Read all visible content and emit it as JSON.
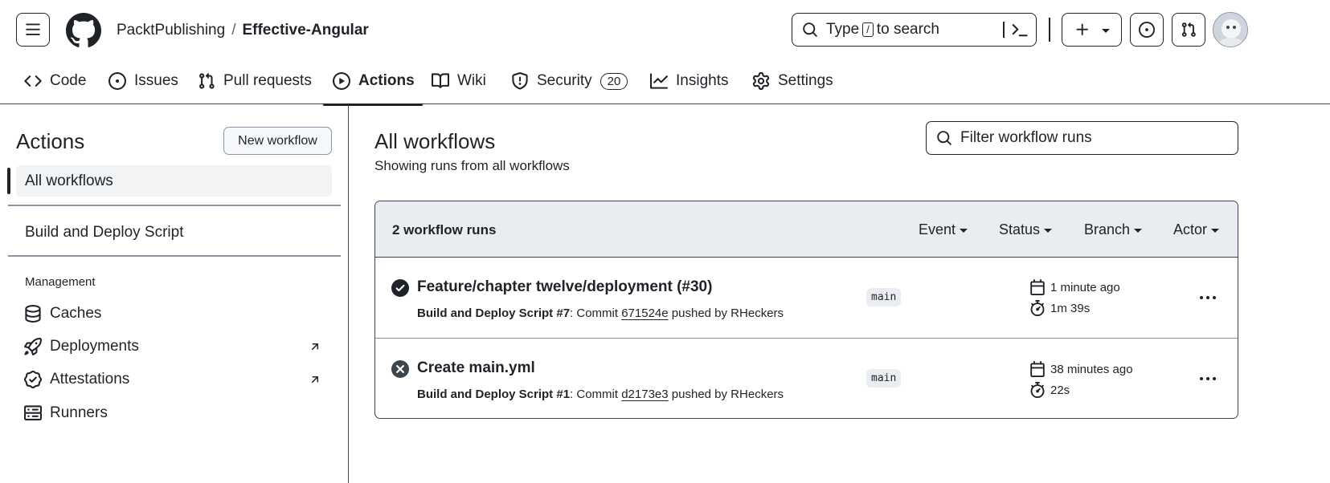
{
  "header": {
    "owner": "PacktPublishing",
    "separator": "/",
    "repo": "Effective-Angular",
    "search_prefix": "Type",
    "search_key": "/",
    "search_suffix": "to search"
  },
  "nav": {
    "tabs": [
      {
        "label": "Code",
        "icon": "code-icon"
      },
      {
        "label": "Issues",
        "icon": "issue-opened-icon"
      },
      {
        "label": "Pull requests",
        "icon": "git-pull-request-icon"
      },
      {
        "label": "Actions",
        "icon": "play-icon",
        "active": true
      },
      {
        "label": "Wiki",
        "icon": "book-icon"
      },
      {
        "label": "Security",
        "icon": "shield-icon",
        "count": "20"
      },
      {
        "label": "Insights",
        "icon": "graph-icon"
      },
      {
        "label": "Settings",
        "icon": "gear-icon"
      }
    ]
  },
  "sidebar": {
    "title": "Actions",
    "new_workflow": "New workflow",
    "active_item": "All workflows",
    "workflow": "Build and Deploy Script",
    "section_label": "Management",
    "management": [
      {
        "label": "Caches",
        "icon": "database-icon"
      },
      {
        "label": "Deployments",
        "icon": "rocket-icon",
        "external": true
      },
      {
        "label": "Attestations",
        "icon": "verified-icon",
        "external": true
      },
      {
        "label": "Runners",
        "icon": "server-icon"
      }
    ]
  },
  "main": {
    "title": "All workflows",
    "subtitle": "Showing runs from all workflows",
    "filter_placeholder": "Filter workflow runs",
    "runs_count": "2 workflow runs",
    "filters": [
      "Event",
      "Status",
      "Branch",
      "Actor"
    ],
    "runs": [
      {
        "status": "success",
        "title": "Feature/chapter twelve/deployment (#30)",
        "workflow": "Build and Deploy Script",
        "run_number": "#7",
        "commit_prefix": ": Commit",
        "sha": "671524e",
        "pushed_by": "pushed by RHeckers",
        "branch": "main",
        "when": "1 minute ago",
        "duration": "1m 39s"
      },
      {
        "status": "cancelled",
        "title": "Create main.yml",
        "workflow": "Build and Deploy Script",
        "run_number": "#1",
        "commit_prefix": ": Commit",
        "sha": "d2173e3",
        "pushed_by": "pushed by RHeckers",
        "branch": "main",
        "when": "38 minutes ago",
        "duration": "22s"
      }
    ]
  },
  "colors": {
    "text": "#1f2328",
    "muted": "#59636e",
    "border": "#8c959f",
    "header_bg": "#e9ecf0"
  }
}
